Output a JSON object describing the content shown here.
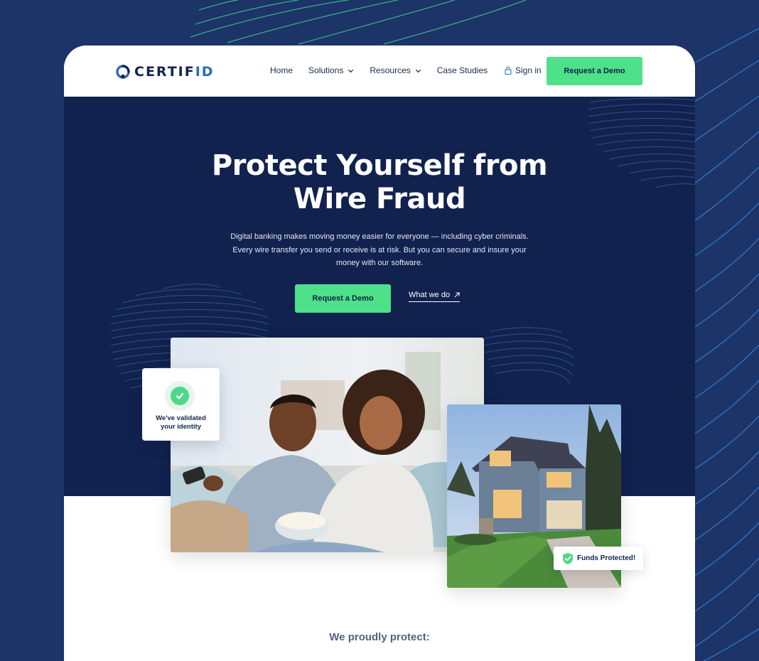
{
  "brand": {
    "name_main": "CERTIF",
    "name_accent": "ID"
  },
  "nav": {
    "items": [
      {
        "label": "Home",
        "has_dropdown": false
      },
      {
        "label": "Solutions",
        "has_dropdown": true
      },
      {
        "label": "Resources",
        "has_dropdown": true
      },
      {
        "label": "Case Studies",
        "has_dropdown": false
      }
    ],
    "sign_in": "Sign in",
    "cta": "Request a Demo"
  },
  "hero": {
    "title_line1": "Protect Yourself from",
    "title_line2": "Wire Fraud",
    "subtitle_line1": "Digital banking makes moving money easier for everyone — including cyber criminals.",
    "subtitle_line2": "Every wire transfer you send or receive is at risk. But you can secure and insure your",
    "subtitle_line3": "money with our software.",
    "primary_cta": "Request a Demo",
    "secondary_link": "What we do"
  },
  "cards": {
    "validated_line1": "We've validated",
    "validated_line2": "your identity",
    "funds": "Funds Protected!"
  },
  "section": {
    "protect_title": "We proudly protect:"
  },
  "colors": {
    "page_bg": "#1d3468",
    "hero_bg": "#12224f",
    "accent_green": "#4fe08a",
    "brand_navy": "#14254d",
    "brand_blue": "#2b6cb7"
  },
  "icons": [
    "certifid-logo-icon",
    "chevron-down-icon",
    "lock-icon",
    "arrow-up-right-icon",
    "checkmark-icon",
    "shield-check-icon"
  ]
}
